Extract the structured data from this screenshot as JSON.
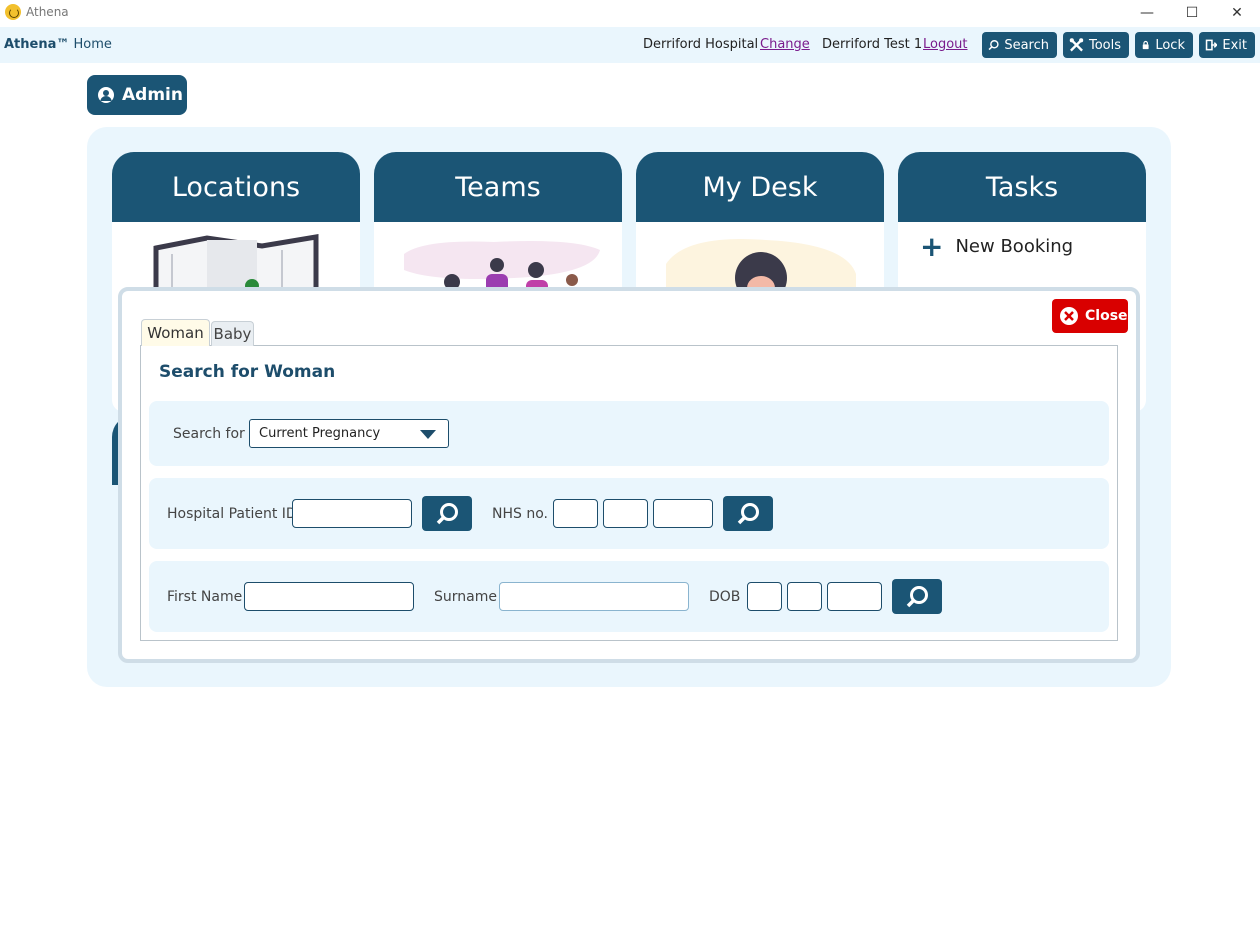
{
  "window": {
    "title": "Athena",
    "minimize": "—",
    "maximize": "☐",
    "close": "✕"
  },
  "topbar": {
    "brand": "Athena™",
    "home": "Home",
    "hospital": "Derriford Hospital",
    "change_link": "Change",
    "user": "Derriford Test 1",
    "logout_link": "Logout",
    "search_label": "Search",
    "tools_label": "Tools",
    "lock_label": "Lock",
    "exit_label": "Exit"
  },
  "admin": {
    "label": "Admin"
  },
  "tiles": [
    {
      "title": "Locations"
    },
    {
      "title": "Teams"
    },
    {
      "title": "My Desk"
    },
    {
      "title": "Tasks"
    }
  ],
  "tasks": {
    "new_booking": "New Booking"
  },
  "modal": {
    "close_label": "Close",
    "tabs": [
      "Woman",
      "Baby"
    ],
    "heading": "Search for Woman",
    "search_for_label": "Search for",
    "search_for_value": "Current Pregnancy",
    "hospital_id_label": "Hospital Patient ID",
    "nhs_label": "NHS no.",
    "first_name_label": "First Name",
    "surname_label": "Surname",
    "dob_label": "DOB"
  },
  "colors": {
    "brand": "#1b5575",
    "panel": "#eaf6fd",
    "close": "#d90000",
    "link": "#7a1b8c"
  }
}
